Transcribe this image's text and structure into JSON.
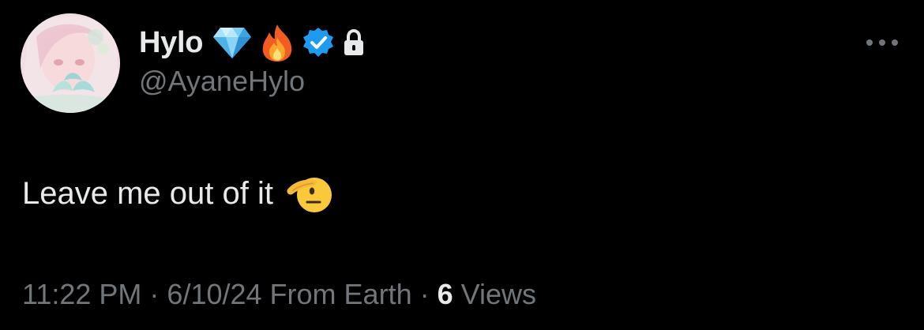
{
  "author": {
    "display_name": "Hylo",
    "handle": "@AyaneHylo",
    "badges": [
      "gem-icon",
      "fire-icon",
      "verified-icon",
      "lock-icon"
    ],
    "verified_color": "#1d9bf0"
  },
  "tweet": {
    "text": "Leave me out of it",
    "emoji": "saluting-face-icon"
  },
  "meta": {
    "time": "11:22 PM",
    "sep1": " · ",
    "date": "6/10/24",
    "source": " From Earth",
    "sep2": " · ",
    "views_count": "6",
    "views_label": " Views"
  },
  "colors": {
    "background": "#000000",
    "primary_text": "#e7e9ea",
    "secondary_text": "#71767b"
  }
}
